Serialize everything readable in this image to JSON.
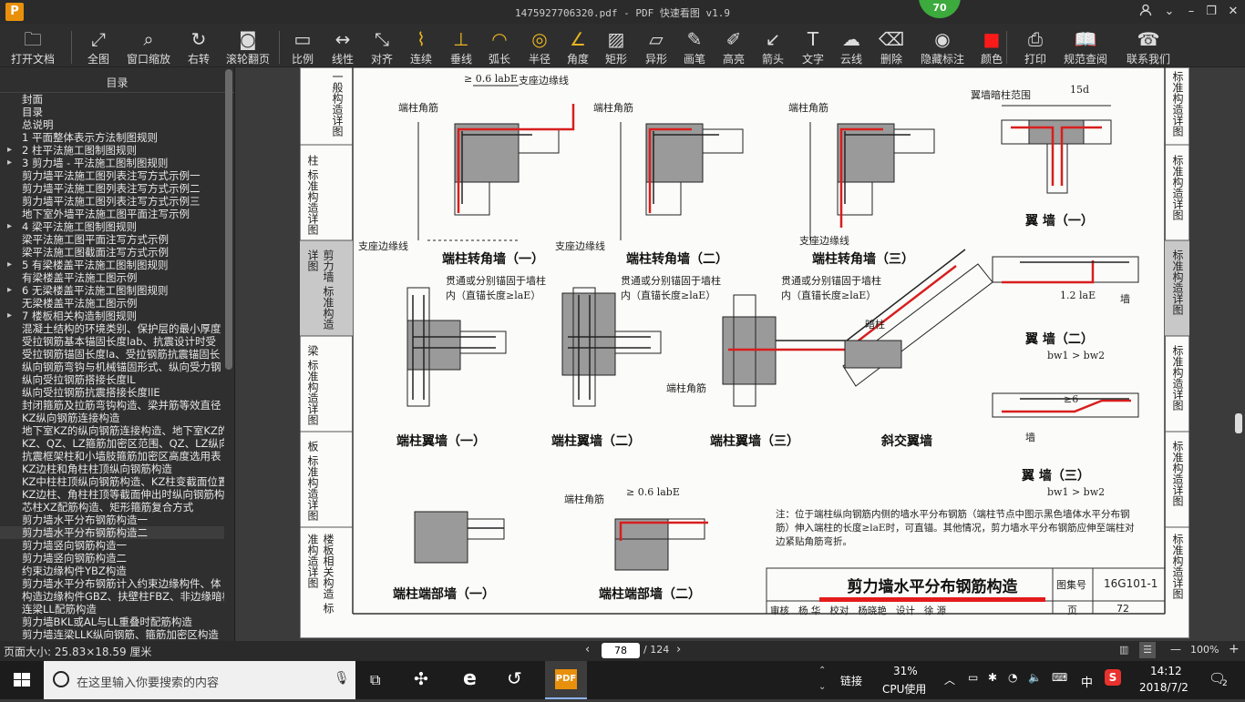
{
  "window": {
    "title": "1475927706320.pdf - PDF 快速看图 v1.9",
    "logo_text": "P",
    "badge": "70",
    "controls": [
      "user-icon",
      "dropdown-icon",
      "minimize-icon",
      "maximize-icon",
      "close-icon"
    ]
  },
  "toolbar": [
    {
      "label": "打开文档",
      "icon": "folder-icon",
      "glyph": "🗀"
    },
    {
      "label": "全图",
      "icon": "fit-page-icon",
      "glyph": "⤢"
    },
    {
      "label": "窗口缩放",
      "icon": "zoom-window-icon",
      "glyph": "⌕"
    },
    {
      "label": "右转",
      "icon": "rotate-right-icon",
      "glyph": "↻"
    },
    {
      "label": "滚轮翻页",
      "icon": "mouse-wheel-icon",
      "glyph": "◙"
    },
    {
      "label": "比例",
      "icon": "scale-icon",
      "glyph": "▭"
    },
    {
      "label": "线性",
      "icon": "linear-measure-icon",
      "glyph": "↔"
    },
    {
      "label": "对齐",
      "icon": "aligned-measure-icon",
      "glyph": "⤡"
    },
    {
      "label": "连续",
      "icon": "continuous-measure-icon",
      "glyph": "⌇"
    },
    {
      "label": "垂线",
      "icon": "perpendicular-icon",
      "glyph": "⊥"
    },
    {
      "label": "弧长",
      "icon": "arc-length-icon",
      "glyph": "◠"
    },
    {
      "label": "半径",
      "icon": "radius-icon",
      "glyph": "◎"
    },
    {
      "label": "角度",
      "icon": "angle-icon",
      "glyph": "∠"
    },
    {
      "label": "矩形",
      "icon": "rectangle-area-icon",
      "glyph": "▨"
    },
    {
      "label": "异形",
      "icon": "polygon-area-icon",
      "glyph": "▱"
    },
    {
      "label": "画笔",
      "icon": "pen-icon",
      "glyph": "✎"
    },
    {
      "label": "高亮",
      "icon": "highlighter-icon",
      "glyph": "✐"
    },
    {
      "label": "箭头",
      "icon": "arrow-icon",
      "glyph": "↙"
    },
    {
      "label": "文字",
      "icon": "text-icon",
      "glyph": "T"
    },
    {
      "label": "云线",
      "icon": "cloud-icon",
      "glyph": "☁"
    },
    {
      "label": "删除",
      "icon": "eraser-icon",
      "glyph": "⌫"
    },
    {
      "label": "隐藏标注",
      "icon": "hide-annotation-icon",
      "glyph": "◉"
    },
    {
      "label": "颜色",
      "icon": "color-swatch-icon",
      "glyph": "■",
      "color": "#ff1a1a"
    },
    {
      "label": "打印",
      "icon": "print-icon",
      "glyph": "⎙"
    },
    {
      "label": "规范查阅",
      "icon": "book-icon",
      "glyph": "📖"
    },
    {
      "label": "联系我们",
      "icon": "support-icon",
      "glyph": "☎"
    }
  ],
  "sidebar": {
    "header": "目录",
    "items": [
      {
        "label": "封面",
        "arrow": false
      },
      {
        "label": "目录",
        "arrow": false
      },
      {
        "label": "总说明",
        "arrow": false
      },
      {
        "label": "1 平面整体表示方法制图规则",
        "arrow": false
      },
      {
        "label": "2 柱平法施工图制图规则",
        "arrow": true
      },
      {
        "label": "3 剪力墙 - 平法施工图制图规则",
        "arrow": true
      },
      {
        "label": "剪力墙平法施工图列表注写方式示例一",
        "arrow": false
      },
      {
        "label": "剪力墙平法施工图列表注写方式示例二",
        "arrow": false
      },
      {
        "label": "剪力墙平法施工图列表注写方式示例三",
        "arrow": false
      },
      {
        "label": "地下室外墙平法施工图平面注写示例",
        "arrow": false
      },
      {
        "label": "4 梁平法施工图制图规则",
        "arrow": true
      },
      {
        "label": "梁平法施工图平面注写方式示例",
        "arrow": false
      },
      {
        "label": "梁平法施工图截面注写方式示例",
        "arrow": false
      },
      {
        "label": "5 有梁楼盖平法施工图制图规则",
        "arrow": true
      },
      {
        "label": "有梁楼盖平法施工图示例",
        "arrow": false
      },
      {
        "label": "6 无梁楼盖平法施工图制图规则",
        "arrow": true
      },
      {
        "label": "无梁楼盖平法施工图示例",
        "arrow": false
      },
      {
        "label": "7 楼板相关构造制图规则",
        "arrow": true
      },
      {
        "label": "混凝土结构的环境类别、保护层的最小厚度",
        "arrow": false
      },
      {
        "label": "受拉钢筋基本锚固长度lab、抗震设计时受",
        "arrow": false
      },
      {
        "label": "受拉钢筋锚固长度la、受拉钢筋抗震锚固长",
        "arrow": false
      },
      {
        "label": "纵向钢筋弯钩与机械锚固形式、纵向受力钢",
        "arrow": false
      },
      {
        "label": "纵向受拉钢筋搭接长度lL",
        "arrow": false
      },
      {
        "label": "纵向受拉钢筋抗震搭接长度llE",
        "arrow": false
      },
      {
        "label": "封闭箍筋及拉筋弯钩构造、梁并筋等效直径",
        "arrow": false
      },
      {
        "label": "KZ纵向钢筋连接构造",
        "arrow": false
      },
      {
        "label": "地下室KZ的纵向钢筋连接构造、地下室KZ的",
        "arrow": false
      },
      {
        "label": "KZ、QZ、LZ箍筋加密区范围、QZ、LZ纵向钢",
        "arrow": false
      },
      {
        "label": "抗震框架柱和小墙肢箍筋加密区高度选用表",
        "arrow": false
      },
      {
        "label": "KZ边柱和角柱柱顶纵向钢筋构造",
        "arrow": false
      },
      {
        "label": "KZ中柱柱顶纵向钢筋构造、KZ柱变截面位置",
        "arrow": false
      },
      {
        "label": "KZ边柱、角柱柱顶等截面伸出时纵向钢筋构",
        "arrow": false
      },
      {
        "label": "芯柱XZ配筋构造、矩形箍筋复合方式",
        "arrow": false
      },
      {
        "label": "剪力墙水平分布钢筋构造一",
        "arrow": false
      },
      {
        "label": "剪力墙水平分布钢筋构造二",
        "arrow": false,
        "selected": true
      },
      {
        "label": "剪力墙竖向钢筋构造一",
        "arrow": false
      },
      {
        "label": "剪力墙竖向钢筋构造二",
        "arrow": false
      },
      {
        "label": "约束边缘构件YBZ构造",
        "arrow": false
      },
      {
        "label": "剪力墙水平分布钢筋计入约束边缘构件、体",
        "arrow": false
      },
      {
        "label": "构造边缘构件GBZ、扶壁柱FBZ、非边缘暗柱",
        "arrow": false
      },
      {
        "label": "连梁LL配筋构造",
        "arrow": false
      },
      {
        "label": "剪力墙BKL或AL与LL重叠时配筋构造",
        "arrow": false
      },
      {
        "label": "剪力墙连梁LLK纵向钢筋、箍筋加密区构造",
        "arrow": false
      }
    ]
  },
  "document": {
    "left_tabs": [
      "一般构造详图",
      "柱 标准构造详图",
      "剪力墙 标准构造详图",
      "梁 标准构造详图",
      "板 标准构造详图",
      "楼板相关构造 标准构造详图"
    ],
    "right_tabs": [
      "标准构造详图",
      "标准构造详图",
      "标准构造详图",
      "标准构造详图",
      "标准构造详图",
      "标准构造详图"
    ],
    "labels": {
      "bearing_edge_line": "支座边缘线",
      "corner_bar": "端柱角筋",
      "anchor_note": "贯通或分别锚固于墙柱内（直锚长度≥laE）",
      "hidden_column": "暗柱",
      "wing_range": "翼墙暗柱范围",
      "wall": "墙",
      "dim_06": "≥ 0.6 labE",
      "dim_15d": "15d",
      "dim_bf": "bf",
      "dim_bw": "bw",
      "dim_12": "1.2 laE",
      "dim_ge6": "≥6",
      "bw_cond": "bw1 > bw2"
    },
    "captions": {
      "c1": "端柱转角墙（一）",
      "c2": "端柱转角墙（二）",
      "c3": "端柱转角墙（三）",
      "w1": "翼 墙（一）",
      "f1": "端柱翼墙（一）",
      "f2": "端柱翼墙（二）",
      "f3": "端柱翼墙（三）",
      "oblique": "斜交翼墙",
      "w2": "翼 墙（二）",
      "w3": "翼 墙（三）",
      "e1": "端柱端部墙（一）",
      "e2": "端柱端部墙（二）"
    },
    "note": "注：位于端柱纵向钢筋内侧的墙水平分布钢筋（端柱节点中图示黑色墙体水平分布钢筋）伸入端柱的长度≥laE时，可直锚。其他情况，剪力墙水平分布钢筋应伸至端柱对边紧贴角筋弯折。",
    "title_block": {
      "title": "剪力墙水平分布钢筋构造",
      "atlas_label": "图集号",
      "atlas_no": "16G101-1",
      "page_label": "页",
      "page_no": "72",
      "sign_row": [
        "审核",
        "杨 华",
        "校对",
        "杨晓艳",
        "设计",
        "徐 源"
      ]
    }
  },
  "status": {
    "page_size": "页面大小: 25.83×18.59 厘米",
    "current_page": "78",
    "total_pages": "/ 124",
    "zoom": "100%",
    "zoom_minus": "—",
    "zoom_plus": "+"
  },
  "taskbar": {
    "search_placeholder": "在这里输入你要搜索的内容",
    "link_label": "链接",
    "cpu_percent": "31%",
    "cpu_label": "CPU使用",
    "ime": "中",
    "time": "14:12",
    "date": "2018/7/2",
    "notif_count": "2"
  },
  "colors": {
    "accent_red": "#e41b1b",
    "drawing_red": "#d81e1e",
    "column_gray": "#9a9a9a"
  }
}
